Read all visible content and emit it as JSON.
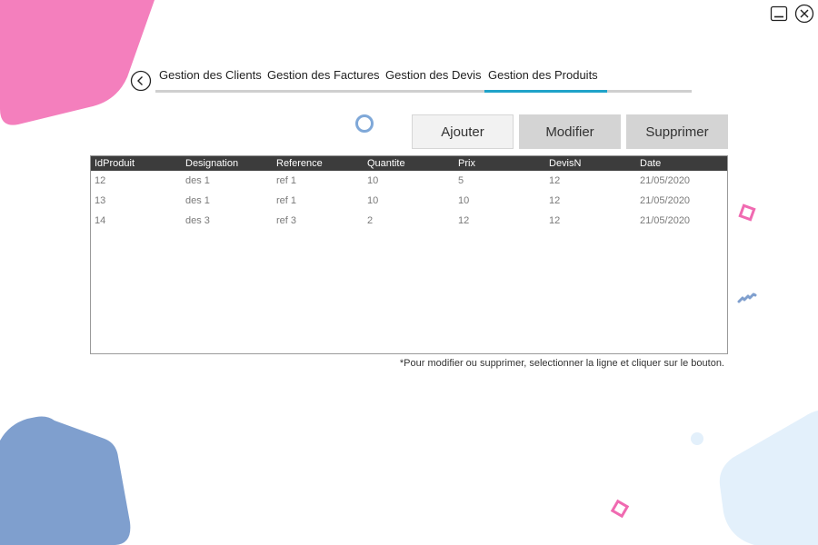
{
  "window": {
    "minimize_icon": "minimize-icon",
    "close_icon": "close-icon"
  },
  "nav": {
    "back_icon": "chevron-left-icon",
    "tabs": [
      {
        "label": "Gestion des Clients",
        "active": false
      },
      {
        "label": "Gestion des Factures",
        "active": false
      },
      {
        "label": "Gestion des Devis",
        "active": false
      },
      {
        "label": "Gestion des Produits",
        "active": true
      }
    ],
    "active_color": "#1fa3c9"
  },
  "toolbar": {
    "add_label": "Ajouter",
    "modify_label": "Modifier",
    "delete_label": "Supprimer"
  },
  "table": {
    "columns": [
      "IdProduit",
      "Designation",
      "Reference",
      "Quantite",
      "Prix",
      "DevisN",
      "Date"
    ],
    "rows": [
      [
        "12",
        "des 1",
        "ref 1",
        "10",
        "5",
        "12",
        "21/05/2020"
      ],
      [
        "13",
        "des 1",
        "ref 1",
        "10",
        "10",
        "12",
        "21/05/2020"
      ],
      [
        "14",
        "des 3",
        "ref 3",
        "2",
        "12",
        "12",
        "21/05/2020"
      ]
    ]
  },
  "hint": "*Pour modifier ou supprimer, selectionner la ligne et cliquer sur le bouton.",
  "colors": {
    "pink": "#f47fbd",
    "blue": "#7f9fce",
    "light_blue": "#e3f0fb",
    "header": "#3c3c3c"
  }
}
